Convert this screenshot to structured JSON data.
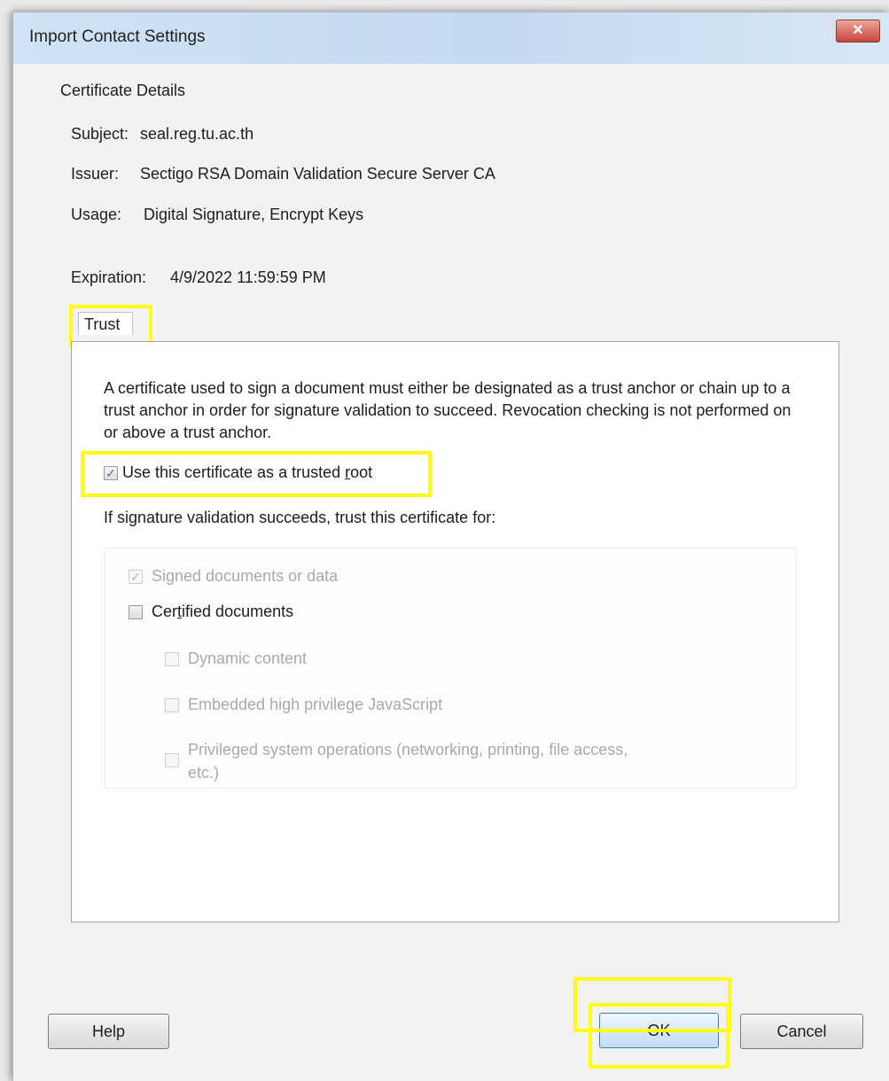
{
  "window": {
    "title": "Import Contact Settings",
    "close_label": "✕"
  },
  "certificate": {
    "section_title": "Certificate Details",
    "subject_label": "Subject:",
    "subject_value": "seal.reg.tu.ac.th",
    "issuer_label": "Issuer:",
    "issuer_value": "Sectigo RSA Domain Validation Secure Server CA",
    "usage_label": "Usage:",
    "usage_value": "Digital Signature, Encrypt Keys",
    "expiration_label": "Expiration:",
    "expiration_value": "4/9/2022 11:59:59 PM"
  },
  "trust": {
    "tab_label": "Trust",
    "description": "A certificate used to sign a document must either be designated as a trust anchor or chain up to a trust anchor in order for signature validation to succeed.  Revocation checking is not performed on or above a trust anchor.",
    "trusted_root_label_pre": "Use this certificate as a trusted ",
    "trusted_root_label_accel": "r",
    "trusted_root_label_post": "oot",
    "trusted_root_checked": true,
    "trust_for_label": "If signature validation succeeds, trust this certificate for:",
    "options": {
      "signed_documents": {
        "label": "Signed documents or data",
        "checked": true,
        "enabled": false
      },
      "certified_documents_pre": "Cer",
      "certified_documents_accel": "t",
      "certified_documents_post": "ified documents",
      "certified_documents_checked": false,
      "dynamic_content": {
        "label": "Dynamic content",
        "checked": false,
        "enabled": false
      },
      "embedded_js": {
        "label": "Embedded high privilege JavaScript",
        "checked": false,
        "enabled": false
      },
      "privileged_ops_line1": "Privileged system operations (networking, printing, file access,",
      "privileged_ops_line2": "etc.)"
    }
  },
  "buttons": {
    "help": "Help",
    "ok": "OK",
    "cancel": "Cancel"
  },
  "colors": {
    "highlight": "#ffff10",
    "titlebar": "#c5d9ef",
    "close_button": "#c9433a"
  }
}
